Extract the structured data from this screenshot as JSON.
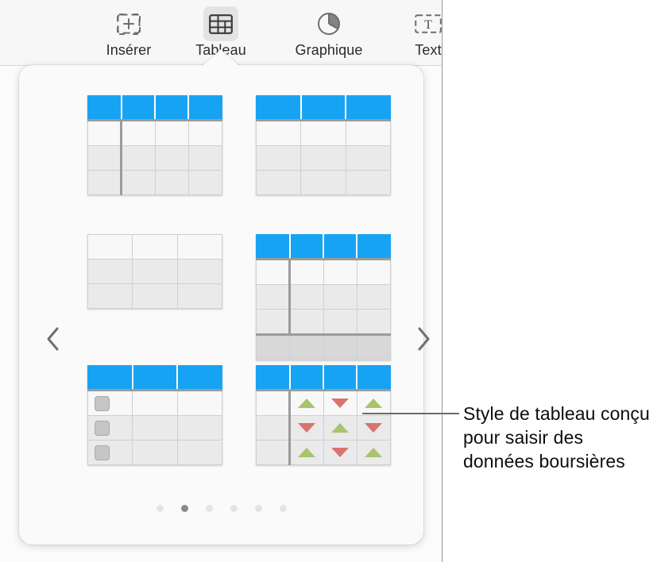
{
  "toolbar": {
    "items": [
      {
        "id": "inserer",
        "label": "Insérer",
        "icon": "insert-media-icon",
        "active": false
      },
      {
        "id": "tableau",
        "label": "Tableau",
        "icon": "table-icon",
        "active": true
      },
      {
        "id": "graphique",
        "label": "Graphique",
        "icon": "pie-chart-icon",
        "active": false
      },
      {
        "id": "texte",
        "label": "Text",
        "icon": "text-box-icon",
        "active": false
      }
    ]
  },
  "popover": {
    "prev_label": "‹",
    "next_label": "›",
    "selected_thumbnail_index": 5,
    "thumbnails": [
      {
        "name": "table-style-basic-4col",
        "columns": 4,
        "body_rows": 3,
        "header": true,
        "footer": false,
        "first_col_divider": true,
        "checkboxes": false,
        "arrows": false
      },
      {
        "name": "table-style-basic-3col",
        "columns": 3,
        "body_rows": 3,
        "header": true,
        "footer": false,
        "first_col_divider": false,
        "checkboxes": false,
        "arrows": false
      },
      {
        "name": "table-style-plain-no-header",
        "columns": 3,
        "body_rows": 3,
        "header": false,
        "footer": false,
        "first_col_divider": false,
        "checkboxes": false,
        "arrows": false
      },
      {
        "name": "table-style-with-footer",
        "columns": 4,
        "body_rows": 3,
        "header": true,
        "footer": true,
        "first_col_divider": true,
        "checkboxes": false,
        "arrows": false
      },
      {
        "name": "table-style-checklist",
        "columns": 3,
        "body_rows": 3,
        "header": true,
        "footer": false,
        "first_col_divider": false,
        "checkboxes": true,
        "arrows": false
      },
      {
        "name": "table-style-stock",
        "columns": 4,
        "body_rows": 3,
        "header": true,
        "footer": false,
        "first_col_divider": true,
        "checkboxes": false,
        "arrows": true,
        "arrow_pattern": [
          [
            "none",
            "up",
            "down",
            "up"
          ],
          [
            "none",
            "down",
            "up",
            "down"
          ],
          [
            "none",
            "up",
            "down",
            "up"
          ]
        ]
      }
    ],
    "pagination": {
      "count": 6,
      "active": 1
    }
  },
  "callout": {
    "text": "Style de tableau conçu pour saisir des données boursières"
  },
  "colors": {
    "header_blue": "#17a3f4",
    "arrow_up_green": "#a9c46a",
    "arrow_down_red": "#d9736f",
    "divider_gray": "#9b9b9b"
  }
}
